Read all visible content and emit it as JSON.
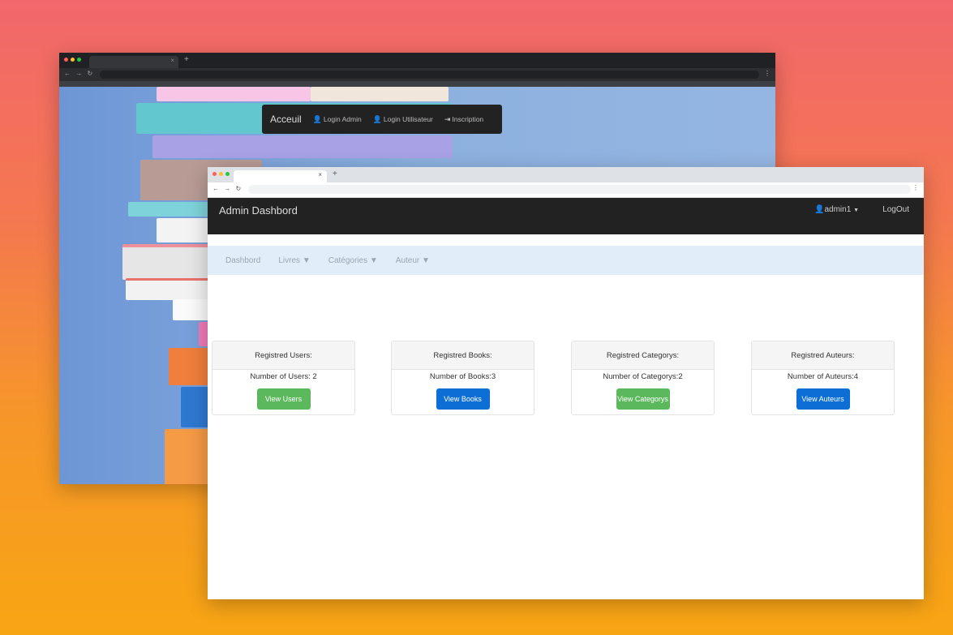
{
  "background_window": {
    "nav": {
      "brand": "Acceuil",
      "links": [
        {
          "label": "Login Admin",
          "icon": "user-icon"
        },
        {
          "label": "Login Utilisateur",
          "icon": "user-icon"
        },
        {
          "label": "Inscription",
          "icon": "sign-in-icon"
        }
      ]
    }
  },
  "front_window": {
    "header": {
      "title": "Admin Dashbord",
      "user": "admin1",
      "logout": "LogOut"
    },
    "subnav": {
      "items": [
        "Dashbord",
        "Livres",
        "Catégories",
        "Auteur"
      ]
    },
    "cards": [
      {
        "title": "Registred Users:",
        "count": "Number of Users: 2",
        "button": "View Users",
        "color": "#5cb85c"
      },
      {
        "title": "Registred Books:",
        "count": "Number of Books:3",
        "button": "View Books",
        "color": "#0d6fd5"
      },
      {
        "title": "Registred Categorys:",
        "count": "Number of Categorys:2",
        "button": "View Categorys",
        "color": "#5cb85c"
      },
      {
        "title": "Registred Auteurs:",
        "count": "Number of Auteurs:4",
        "button": "View Auteurs",
        "color": "#0d6fd5"
      }
    ]
  },
  "colors": {
    "gradient_top": "#f2676c",
    "gradient_bottom": "#f8a513",
    "navbar": "#222222",
    "subnav": "#e1eef9"
  }
}
